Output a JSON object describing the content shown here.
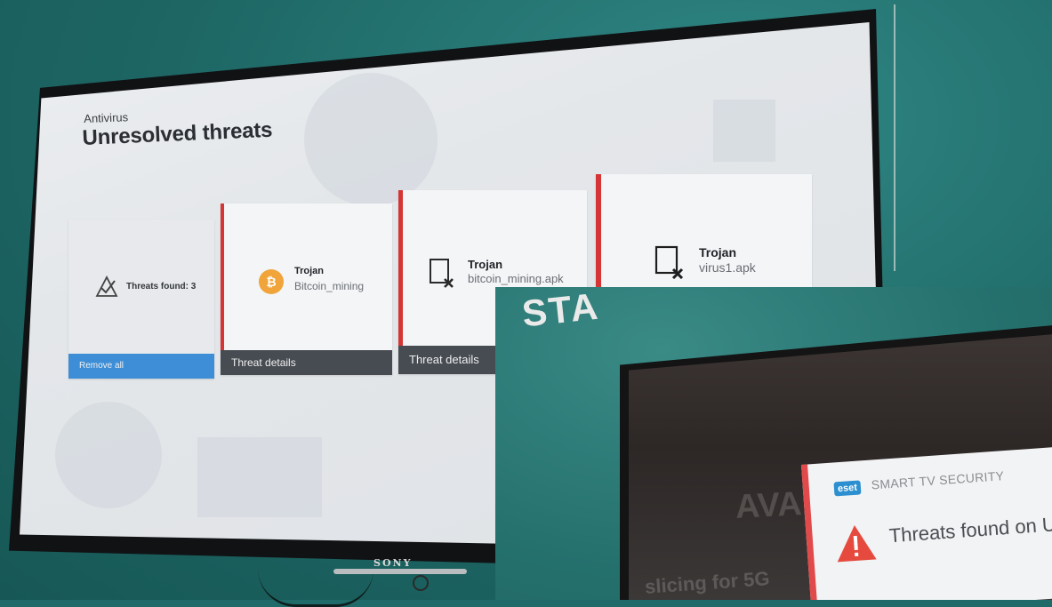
{
  "tv": {
    "brand": "SONY"
  },
  "app": {
    "section_label": "Antivirus",
    "page_title": "Unresolved threats"
  },
  "summary_card": {
    "label": "Threats found: 3",
    "button_label": "Remove all"
  },
  "threats": [
    {
      "name": "Trojan",
      "file": "Bitcoin_mining",
      "action_label": "Threat details",
      "icon": "bitcoin-app-icon"
    },
    {
      "name": "Trojan",
      "file": "bitcoin_mining.apk",
      "action_label": "Threat details",
      "icon": "infected-file-icon"
    },
    {
      "name": "Trojan",
      "file": "virus1.apk",
      "icon": "infected-file-icon"
    }
  ],
  "notification": {
    "logo_text": "eset",
    "product": "SMART TV SECURITY",
    "title": "Threats found on U"
  },
  "colors": {
    "accent_red": "#d53535",
    "remove_all_blue": "#3d8ed6",
    "footer_dark": "#474c52",
    "wall_teal": "#1f6b6a"
  }
}
